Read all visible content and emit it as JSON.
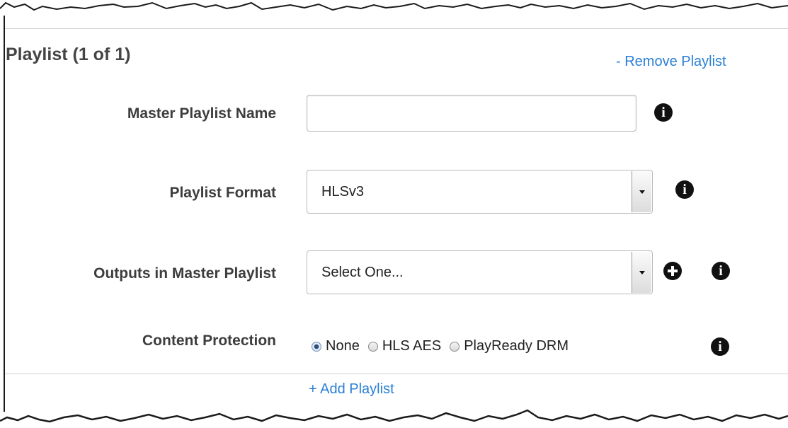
{
  "section": {
    "title": "Playlist (1 of 1)",
    "remove_link": "- Remove Playlist",
    "add_link": "+ Add Playlist"
  },
  "fields": {
    "master_playlist_name": {
      "label": "Master Playlist Name",
      "value": ""
    },
    "playlist_format": {
      "label": "Playlist Format",
      "selected": "HLSv3"
    },
    "outputs_in_master_playlist": {
      "label": "Outputs in Master Playlist",
      "selected": "Select One..."
    },
    "content_protection": {
      "label": "Content Protection",
      "options": [
        "None",
        "HLS AES",
        "PlayReady DRM"
      ],
      "selected": "None"
    }
  },
  "icons": {
    "info": "info-icon",
    "add": "add-icon",
    "dropdown": "chevron-down-icon"
  },
  "colors": {
    "link": "#2a7fd4",
    "label": "#3d3d3d",
    "title": "#444444",
    "icon": "#111111"
  }
}
